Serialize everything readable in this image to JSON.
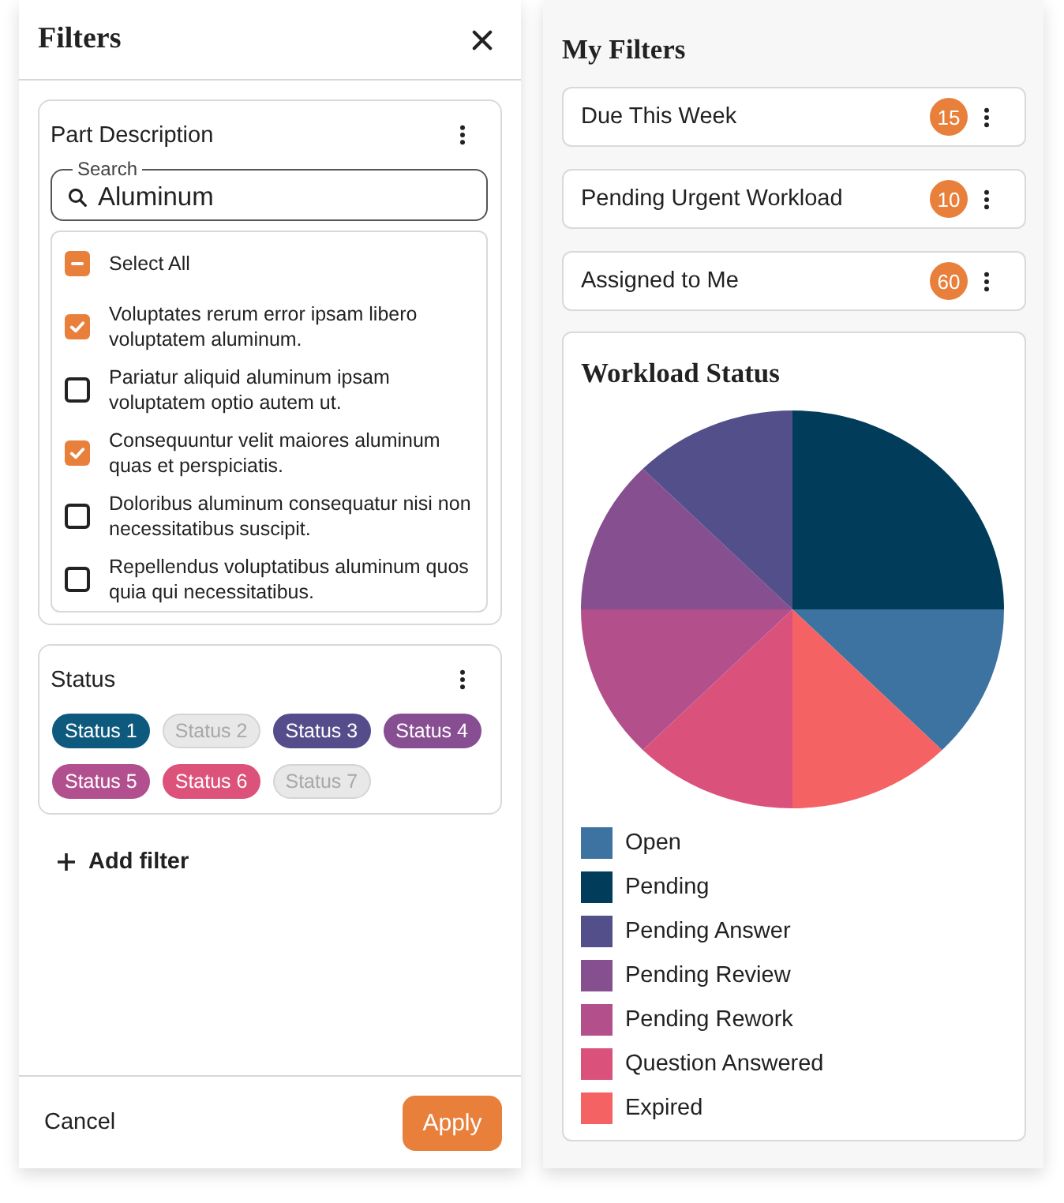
{
  "filters_panel": {
    "title": "Filters",
    "part_description": {
      "title": "Part Description",
      "search": {
        "label": "Search",
        "value": "Aluminum"
      },
      "select_all": {
        "label": "Select All",
        "indeterminate": true
      },
      "options": [
        {
          "label": "Voluptates rerum error ipsam libero voluptatem aluminum.",
          "checked": true
        },
        {
          "label": "Pariatur aliquid aluminum ipsam voluptatem optio autem ut.",
          "checked": false
        },
        {
          "label": "Consequuntur velit maiores aluminum quas et perspiciatis.",
          "checked": true
        },
        {
          "label": "Doloribus aluminum consequatur nisi non necessitatibus suscipit.",
          "checked": false
        },
        {
          "label": "Repellendus voluptatibus aluminum quos quia qui necessitatibus.",
          "checked": false
        }
      ]
    },
    "status": {
      "title": "Status",
      "chips": [
        {
          "label": "Status 1",
          "selected": true,
          "color": "#0e5a7e"
        },
        {
          "label": "Status 2",
          "selected": false
        },
        {
          "label": "Status 3",
          "selected": true,
          "color": "#554c8b"
        },
        {
          "label": "Status 4",
          "selected": true,
          "color": "#874e92"
        },
        {
          "label": "Status 5",
          "selected": true,
          "color": "#b24f8e"
        },
        {
          "label": "Status 6",
          "selected": true,
          "color": "#dc527b"
        },
        {
          "label": "Status 7",
          "selected": false
        }
      ]
    },
    "add_filter": "Add filter",
    "footer": {
      "cancel": "Cancel",
      "apply": "Apply"
    }
  },
  "my_filters": {
    "title": "My Filters",
    "items": [
      {
        "label": "Due This Week",
        "count": "15"
      },
      {
        "label": "Pending Urgent Workload",
        "count": "10"
      },
      {
        "label": "Assigned to Me",
        "count": "60"
      }
    ],
    "chart": {
      "title": "Workload Status",
      "legend": [
        {
          "label": "Open",
          "color": "#3d73a0"
        },
        {
          "label": "Pending",
          "color": "#013d5a"
        },
        {
          "label": "Pending Answer",
          "color": "#534f8a"
        },
        {
          "label": "Pending Review",
          "color": "#864f8f"
        },
        {
          "label": "Pending Rework",
          "color": "#b3508b"
        },
        {
          "label": "Question Answered",
          "color": "#da527b"
        },
        {
          "label": "Expired",
          "color": "#f46264"
        }
      ]
    }
  }
}
